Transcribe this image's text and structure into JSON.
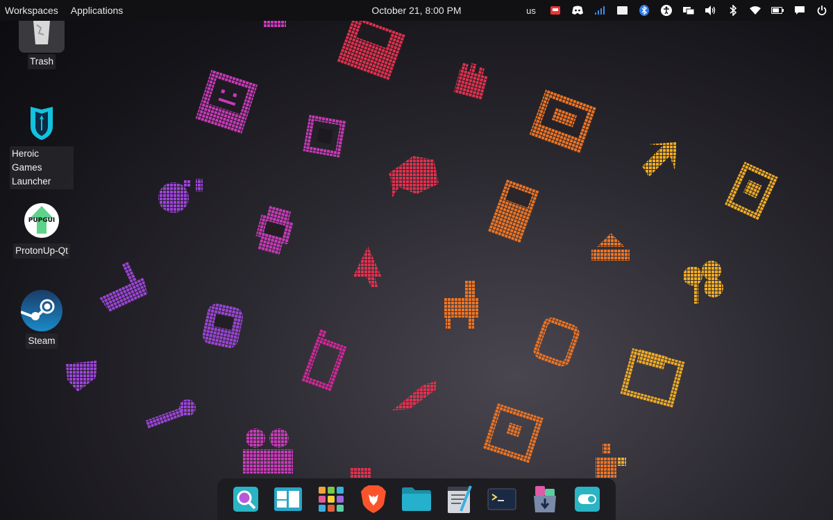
{
  "topbar": {
    "workspaces": "Workspaces",
    "applications": "Applications",
    "clock": "October 21, 8:00 PM",
    "keyboard_layout": "us"
  },
  "tray_icons": [
    "app-indicator-icon",
    "discord-icon",
    "signal-strength-icon",
    "window-icon",
    "bluetooth-app-icon",
    "accessibility-icon",
    "display-icon",
    "volume-icon",
    "bluetooth-icon",
    "wifi-icon",
    "battery-icon",
    "notifications-icon",
    "power-icon"
  ],
  "desktop": {
    "trash": "Trash",
    "heroic": "Heroic Games Launcher",
    "protonup": "ProtonUp-Qt",
    "protonup_badge": "PUPGUI",
    "steam": "Steam"
  },
  "dock": {
    "items": [
      "search-app",
      "workspaces-app",
      "app-grid",
      "brave-browser",
      "files",
      "text-editor",
      "terminal",
      "software-center",
      "settings-toggle-app"
    ]
  },
  "colors": {
    "topbar_bg": "#111114",
    "dock_bg": "#1d1d21",
    "glyph_pink": "#e0209a",
    "glyph_purple": "#a040d0",
    "glyph_red": "#e0304a",
    "glyph_orange": "#f07a20",
    "glyph_yellow": "#f0b020"
  }
}
